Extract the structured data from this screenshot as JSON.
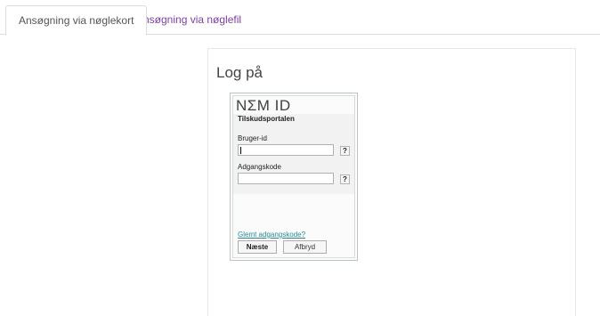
{
  "tabs": [
    {
      "label": "Ansøgning via nøglekort",
      "active": true
    },
    {
      "label": "Ansøgning via nøglefil",
      "active": false
    }
  ],
  "colors": {
    "tab_link": "#7b3fa0",
    "link": "#2a8a94",
    "border": "#dddddd"
  },
  "login": {
    "title": "Log på",
    "nemid": {
      "logo": "NΣM ID",
      "portal": "Tilskudsportalen",
      "user_label": "Bruger-id",
      "user_value": "",
      "password_label": "Adgangskode",
      "password_value": "",
      "help": "?",
      "forgot": "Glemt adgangskode?",
      "next": "Næste",
      "cancel": "Afbryd"
    }
  }
}
